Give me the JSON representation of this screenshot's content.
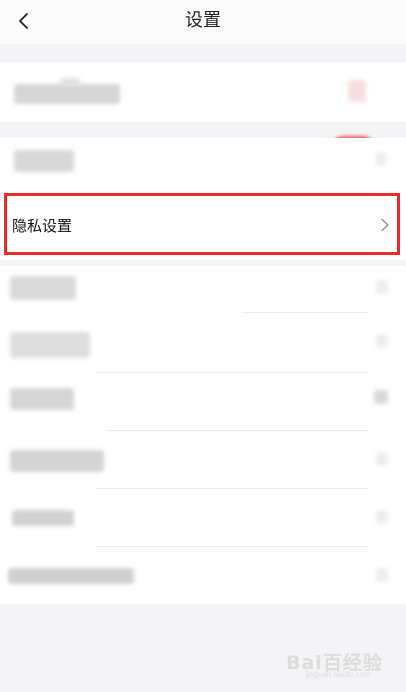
{
  "header": {
    "title": "设置",
    "back_icon": "chevron-left-icon"
  },
  "privacy_row": {
    "label": "隐私设置",
    "chevron_icon": "chevron-right-icon"
  },
  "colors": {
    "highlight_border": "#e82a2a",
    "toggle_on": "#f25a5a",
    "background": "#f4f4f6",
    "row_background": "#ffffff"
  },
  "watermark": {
    "brand": "Bai百经验",
    "sub": "jingyan.baidu.com"
  }
}
